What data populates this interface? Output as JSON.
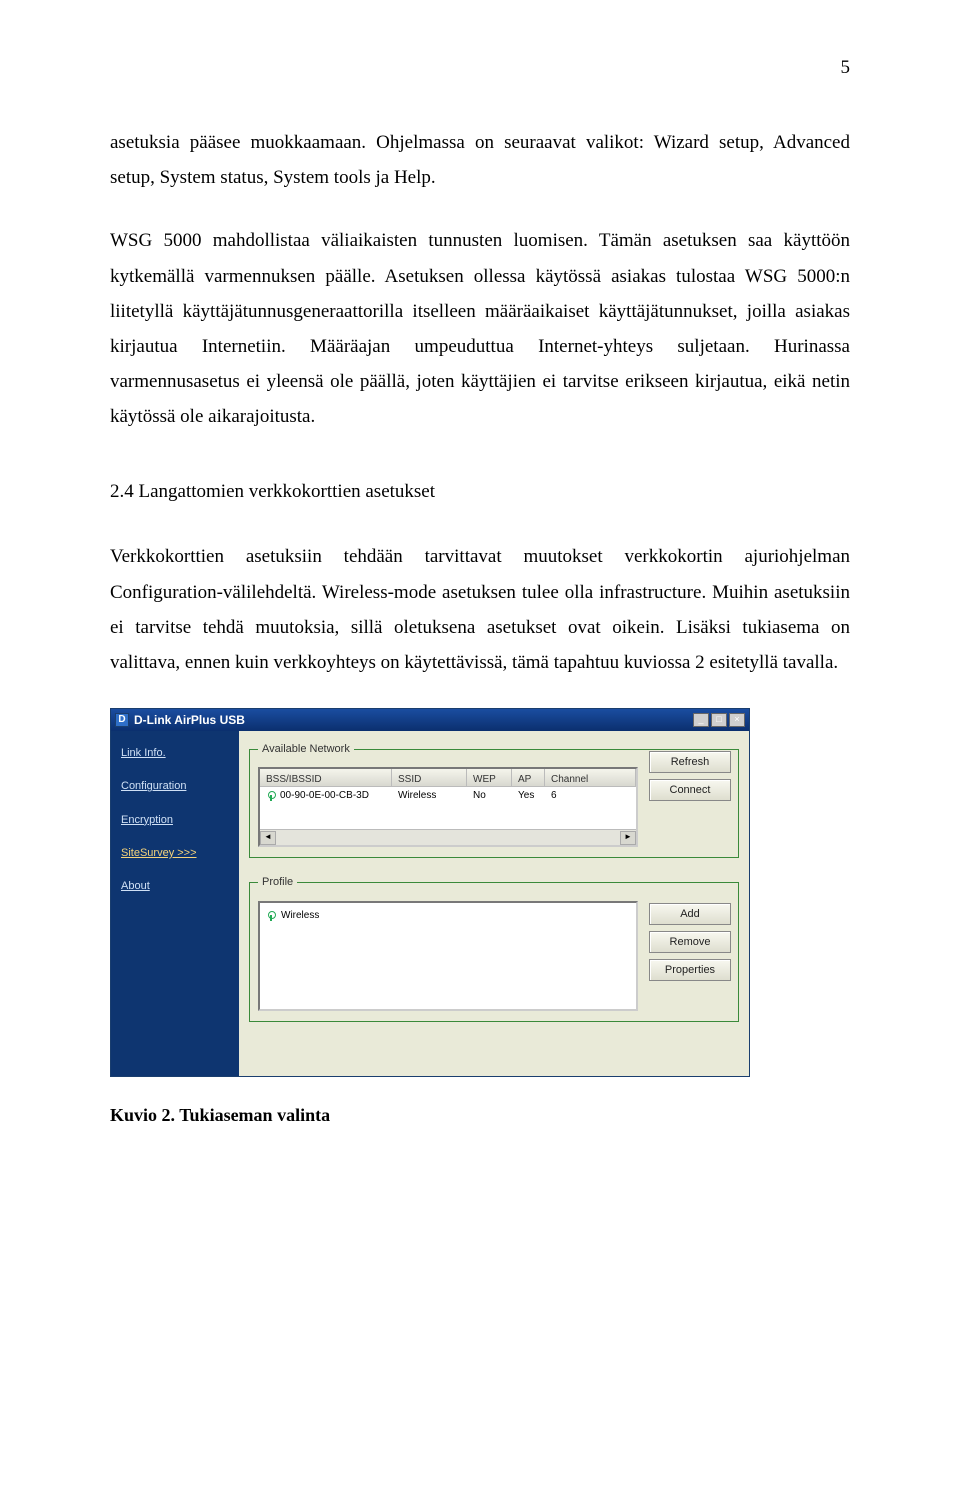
{
  "page_number": "5",
  "para1": "asetuksia pääsee muokkaamaan. Ohjelmassa on seuraavat valikot: Wizard setup, Advanced setup, System status, System tools ja Help.",
  "para2": "WSG 5000 mahdollistaa väliaikaisten tunnusten luomisen. Tämän asetuksen saa käyttöön kytkemällä varmennuksen päälle. Asetuksen ollessa käytössä asiakas tulostaa WSG 5000:n liitetyllä käyttäjätunnusgeneraattorilla itselleen määräaikaiset käyttäjätunnukset, joilla asiakas kirjautua Internetiin. Määräajan umpeuduttua Internet-yhteys suljetaan. Hurinassa varmennusasetus ei yleensä ole päällä, joten käyttäjien ei tarvitse erikseen kirjautua, eikä netin käytössä ole aikarajoitusta.",
  "section_heading": "2.4 Langattomien verkkokorttien asetukset",
  "para3": "Verkkokorttien asetuksiin tehdään tarvittavat muutokset verkkokortin ajuriohjelman Configuration-välilehdeltä. Wireless-mode asetuksen tulee olla infrastructure. Muihin asetuksiin ei tarvitse tehdä muutoksia, sillä oletuksena asetukset ovat oikein. Lisäksi tukiasema on valittava, ennen kuin verkkoyhteys on käytettävissä, tämä tapahtuu kuviossa 2 esitetyllä tavalla.",
  "caption": "Kuvio 2. Tukiaseman valinta",
  "screenshot": {
    "titlebar": {
      "icon_letter": "D",
      "title": "D-Link AirPlus USB"
    },
    "win_buttons": {
      "minimize": "_",
      "maximize": "□",
      "close": "×"
    },
    "sidebar": {
      "items": [
        {
          "label": "Link Info."
        },
        {
          "label": "Configuration"
        },
        {
          "label": "Encryption"
        },
        {
          "label": "SiteSurvey >>>"
        },
        {
          "label": "About"
        }
      ]
    },
    "available_legend": "Available Network",
    "profile_legend": "Profile",
    "columns": {
      "bss": "BSS/IBSSID",
      "ssid": "SSID",
      "wep": "WEP",
      "ap": "AP",
      "channel": "Channel"
    },
    "row": {
      "bss": "00-90-0E-00-CB-3D",
      "ssid": "Wireless",
      "wep": "No",
      "ap": "Yes",
      "channel": "6"
    },
    "scroll": {
      "left": "◄",
      "right": "►"
    },
    "buttons": {
      "refresh": "Refresh",
      "connect": "Connect",
      "add": "Add",
      "remove": "Remove",
      "properties": "Properties"
    },
    "profile_row": "Wireless"
  }
}
